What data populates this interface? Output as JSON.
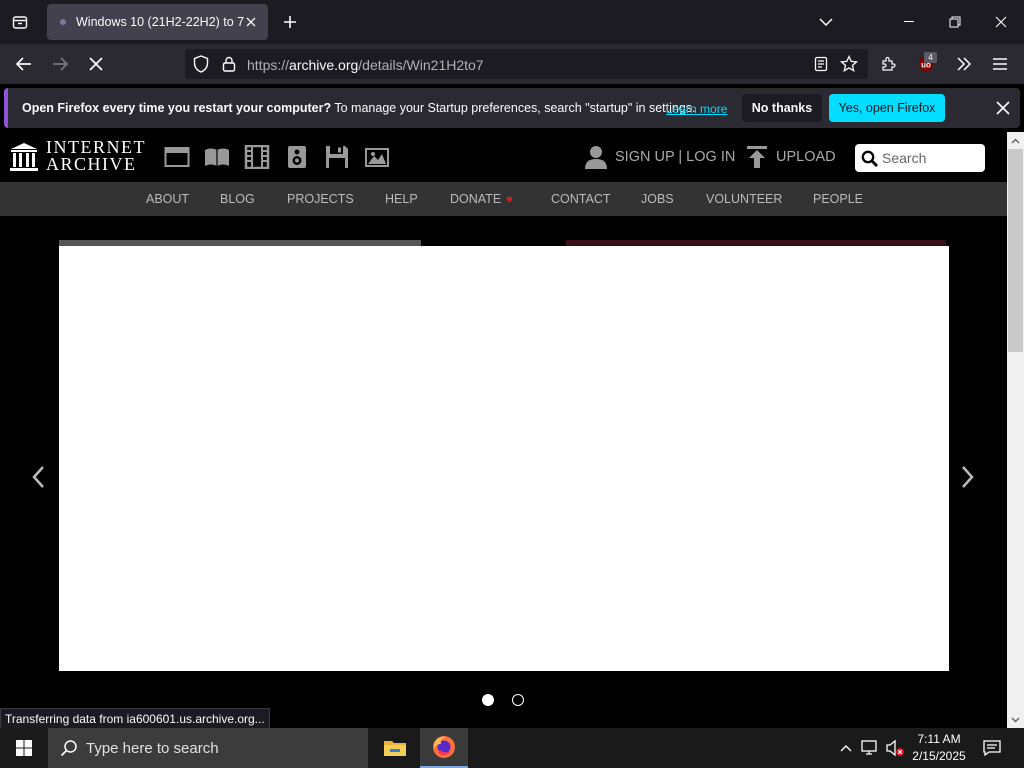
{
  "browser": {
    "tab_title": "Windows 10 (21H2-22H2) to 7",
    "url_prefix": "https://",
    "url_host": "archive.org",
    "url_path": "/details/Win21H2to7",
    "extension_badge": "4"
  },
  "notification": {
    "bold_text": "Open Firefox every time you restart your computer?",
    "text": " To manage your Startup preferences, search \"startup\" in settings.",
    "link": "Learn more",
    "no_thanks": "No thanks",
    "yes": "Yes, open Firefox"
  },
  "ia": {
    "logo_line1": "INTERNET",
    "logo_line2": "ARCHIVE",
    "signup": "SIGN UP | LOG IN",
    "upload": "UPLOAD",
    "search_placeholder": "Search",
    "nav": [
      "ABOUT",
      "BLOG",
      "PROJECTS",
      "HELP",
      "DONATE",
      "CONTACT",
      "JOBS",
      "VOLUNTEER",
      "PEOPLE"
    ],
    "donate_heart": "♥"
  },
  "status_text": "Transferring data from ia600601.us.archive.org...",
  "taskbar": {
    "search_text": "Type here to search",
    "time": "7:11 AM",
    "date": "2/15/2025"
  },
  "colors": {
    "accent_cyan": "#00ddff",
    "notif_border": "#8f53d8",
    "donate_red": "#e01f1f"
  }
}
